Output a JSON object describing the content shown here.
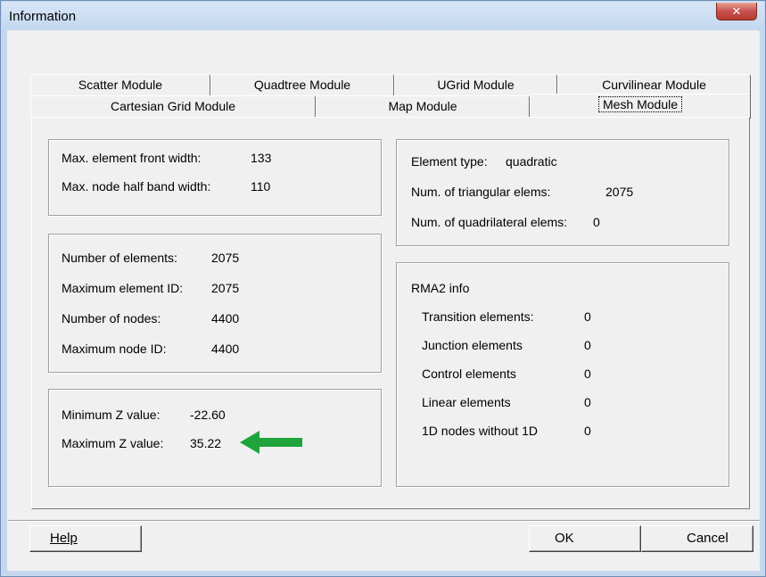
{
  "window": {
    "title": "Information",
    "close_glyph": "✕"
  },
  "tabs": {
    "row1": [
      "Scatter Module",
      "Quadtree Module",
      "UGrid Module",
      "Curvilinear Module"
    ],
    "row2": [
      "Cartesian Grid Module",
      "Map Module",
      "Mesh Module"
    ],
    "active": "Mesh Module"
  },
  "front_width_group": {
    "max_front_width_label": "Max. element front width:",
    "max_front_width_value": "133",
    "max_half_band_label": "Max. node half band width:",
    "max_half_band_value": "110"
  },
  "element_type_group": {
    "element_type_label": "Element type:",
    "element_type_value": "quadratic",
    "num_tri_label": "Num. of triangular elems:",
    "num_tri_value": "2075",
    "num_quad_label": "Num. of quadrilateral elems:",
    "num_quad_value": "0"
  },
  "counts_group": {
    "num_elements_label": "Number of elements:",
    "num_elements_value": "2075",
    "max_element_id_label": "Maximum element ID:",
    "max_element_id_value": "2075",
    "num_nodes_label": "Number of nodes:",
    "num_nodes_value": "4400",
    "max_node_id_label": "Maximum node ID:",
    "max_node_id_value": "4400"
  },
  "rma2_group": {
    "title": "RMA2 info",
    "transition_label": "Transition elements:",
    "transition_value": "0",
    "junction_label": "Junction elements",
    "junction_value": "0",
    "control_label": "Control elements",
    "control_value": "0",
    "linear_label": "Linear elements",
    "linear_value": "0",
    "nodes_without_1d_label": "1D nodes without 1D",
    "nodes_without_1d_value": "0"
  },
  "z_group": {
    "min_z_label": "Minimum Z value:",
    "min_z_value": "-22.60",
    "max_z_label": "Maximum Z value:",
    "max_z_value": "35.22"
  },
  "annotation": {
    "arrow_color": "#1fa43c",
    "arrow_icon": "arrow-left-icon"
  },
  "buttons": {
    "help": "Help",
    "ok": "OK",
    "cancel": "Cancel"
  }
}
